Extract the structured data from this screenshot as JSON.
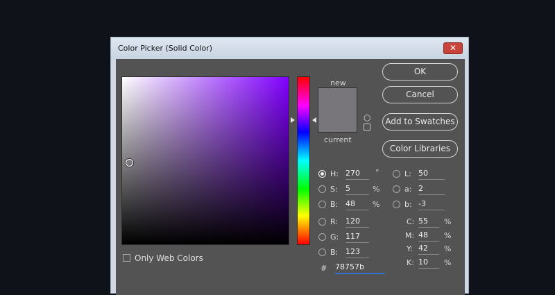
{
  "window": {
    "title": "Color Picker (Solid Color)",
    "close_glyph": "✕"
  },
  "swatch": {
    "new_label": "new",
    "current_label": "current",
    "new_color": "#78757b",
    "current_color": "#78757b"
  },
  "buttons": {
    "ok": "OK",
    "cancel": "Cancel",
    "add_to_swatches": "Add to Swatches",
    "color_libraries": "Color Libraries"
  },
  "fields": {
    "hsb": [
      {
        "label": "H:",
        "value": "270",
        "unit": "°",
        "selected": true
      },
      {
        "label": "S:",
        "value": "5",
        "unit": "%",
        "selected": false
      },
      {
        "label": "B:",
        "value": "48",
        "unit": "%",
        "selected": false
      }
    ],
    "rgb": [
      {
        "label": "R:",
        "value": "120"
      },
      {
        "label": "G:",
        "value": "117"
      },
      {
        "label": "B:",
        "value": "123"
      }
    ],
    "lab": [
      {
        "label": "L:",
        "value": "50"
      },
      {
        "label": "a:",
        "value": "2"
      },
      {
        "label": "b:",
        "value": "-3"
      }
    ],
    "cmyk": [
      {
        "label": "C:",
        "value": "55",
        "unit": "%"
      },
      {
        "label": "M:",
        "value": "48",
        "unit": "%"
      },
      {
        "label": "Y:",
        "value": "42",
        "unit": "%"
      },
      {
        "label": "K:",
        "value": "10",
        "unit": "%"
      }
    ],
    "hex_label": "#",
    "hex_value": "78757b"
  },
  "options": {
    "only_web_colors": "Only Web Colors",
    "only_web_colors_checked": false
  },
  "icons": {
    "cube": "cube-icon",
    "cube_glyph": "⬡"
  }
}
